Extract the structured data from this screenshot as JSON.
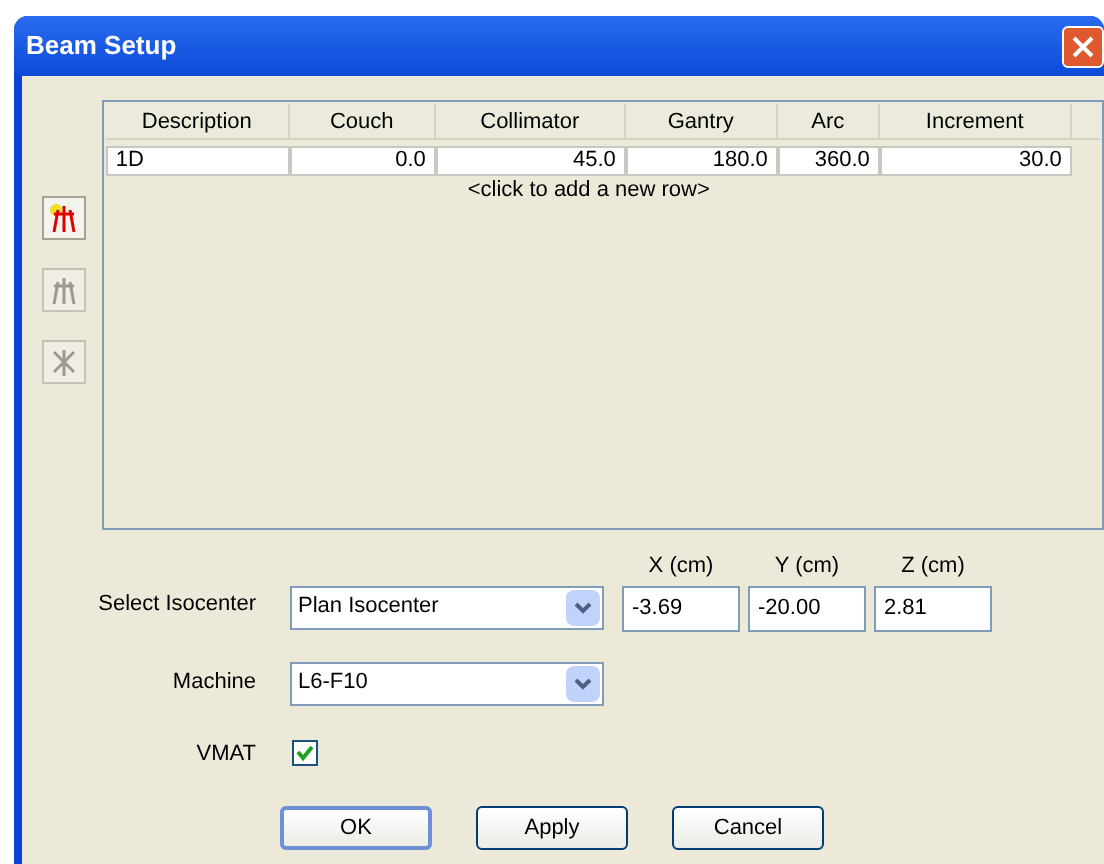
{
  "window": {
    "title": "Beam Setup"
  },
  "side_buttons": [
    {
      "disabled": false
    },
    {
      "disabled": true
    },
    {
      "disabled": true
    }
  ],
  "table": {
    "columns": [
      "Description",
      "Couch",
      "Collimator",
      "Gantry",
      "Arc",
      "Increment"
    ],
    "rows": [
      [
        "1D",
        "0.0",
        "45.0",
        "180.0",
        "360.0",
        "30.0"
      ]
    ],
    "add_row_hint": "<click to add a new row>"
  },
  "isocenter": {
    "label": "Select Isocenter",
    "value": "Plan Isocenter",
    "coords": [
      {
        "label": "X (cm)",
        "value": "-3.69"
      },
      {
        "label": "Y (cm)",
        "value": "-20.00"
      },
      {
        "label": "Z (cm)",
        "value": "2.81"
      }
    ]
  },
  "machine": {
    "label": "Machine",
    "value": "L6-F10"
  },
  "vmat": {
    "label": "VMAT",
    "checked": true
  },
  "buttons": [
    {
      "label": "OK",
      "default": true
    },
    {
      "label": "Apply",
      "default": false
    },
    {
      "label": "Cancel",
      "default": false
    }
  ]
}
